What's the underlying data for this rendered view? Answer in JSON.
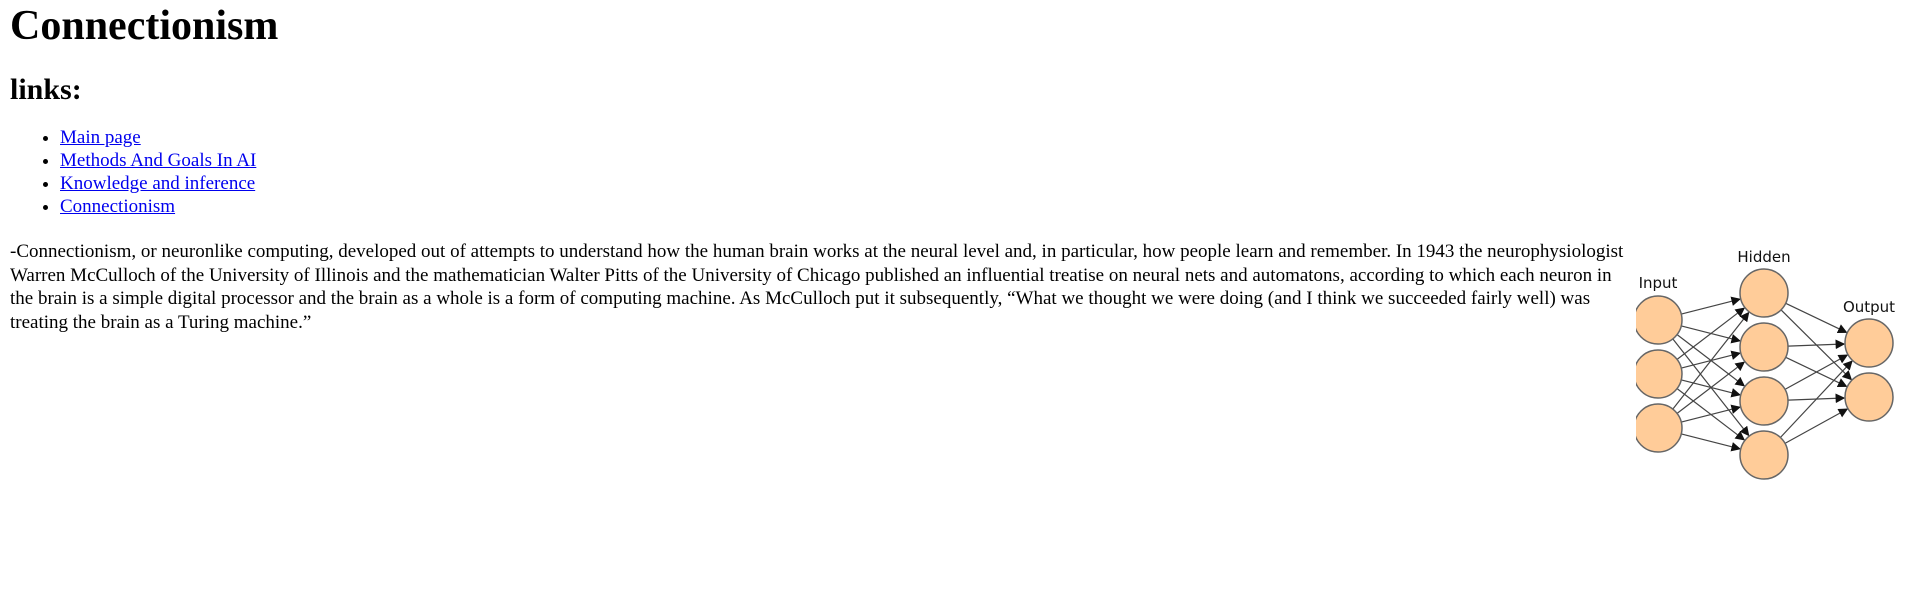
{
  "page": {
    "title": "Connectionism",
    "subtitle": "links:"
  },
  "nav": {
    "links": [
      {
        "label": "Main page"
      },
      {
        "label": "Methods And Goals In AI"
      },
      {
        "label": "Knowledge and inference"
      },
      {
        "label": "Connectionism"
      }
    ]
  },
  "article": {
    "text": "-Connectionism, or neuronlike computing, developed out of attempts to understand how the human brain works at the neural level and, in particular, how people learn and remember. In 1943 the neurophysiologist Warren McCulloch of the University of Illinois and the mathematician Walter Pitts of the University of Chicago published an influential treatise on neural nets and automatons, according to which each neuron in the brain is a simple digital processor and the brain as a whole is a form of computing machine. As McCulloch put it subsequently, “What we thought we were doing (and I think we succeeded fairly well) was treating the brain as a Turing machine.”"
  },
  "diagram": {
    "input_label": "Input",
    "hidden_label": "Hidden",
    "output_label": "Output",
    "node_fill": "#ffcc99",
    "node_stroke": "#666666",
    "edge_color": "#444444"
  }
}
